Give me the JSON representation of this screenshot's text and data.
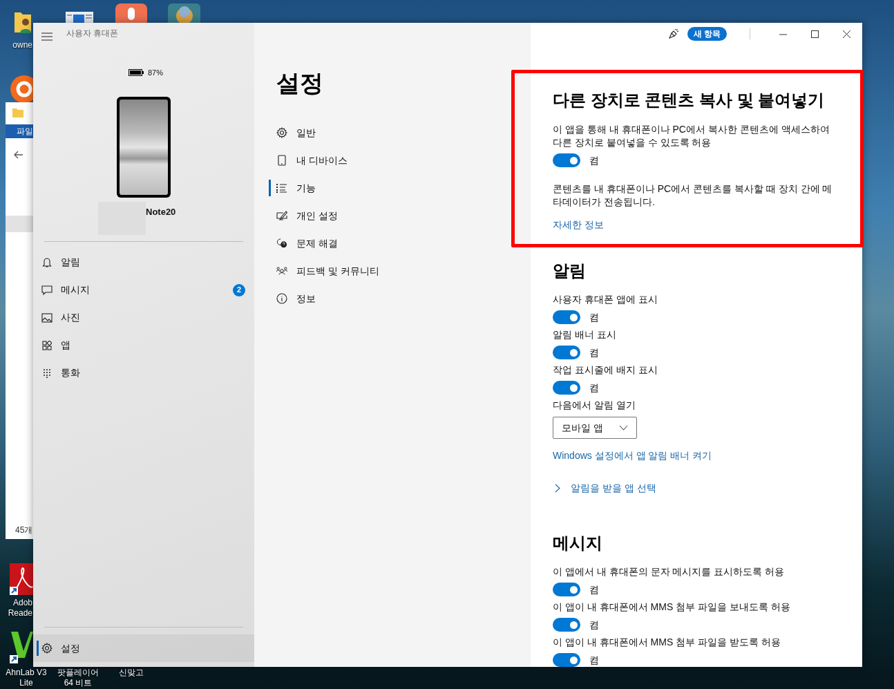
{
  "desktop": {
    "icons": [
      {
        "lines": [
          "owne"
        ]
      },
      {
        "lines": [
          "Adob",
          "Reade"
        ]
      },
      {
        "lines": [
          "AhnLab V3",
          "Lite"
        ]
      },
      {
        "lines": [
          "팟플레이어",
          "64 비트"
        ]
      },
      {
        "lines": [
          "신맞고"
        ]
      }
    ]
  },
  "background_window": {
    "ribbon_tab": "파일",
    "status": "45개"
  },
  "app": {
    "title": "사용자 휴대폰",
    "battery": "87%",
    "device_name": "Note20",
    "nav": [
      {
        "label": "알림",
        "selected": false
      },
      {
        "label": "메시지",
        "selected": false,
        "badge": "2"
      },
      {
        "label": "사진",
        "selected": false
      },
      {
        "label": "앱",
        "selected": false
      },
      {
        "label": "통화",
        "selected": false
      }
    ],
    "footer_nav": {
      "label": "설정",
      "selected": true
    },
    "settings_title": "설정",
    "settings_nav": [
      {
        "label": "일반",
        "selected": false
      },
      {
        "label": "내 디바이스",
        "selected": false
      },
      {
        "label": "기능",
        "selected": true
      },
      {
        "label": "개인 설정",
        "selected": false
      },
      {
        "label": "문제 해결",
        "selected": false
      },
      {
        "label": "피드백 및 커뮤니티",
        "selected": false
      },
      {
        "label": "정보",
        "selected": false
      }
    ],
    "whats_new": "새 항목",
    "sections": [
      {
        "title": "다른 장치로 콘텐츠 복사 및 붙여넣기",
        "highlighted": true,
        "rows": [
          {
            "kind": "description",
            "text": "이 앱을 통해 내 휴대폰이나 PC에서 복사한 콘텐츠에 액세스하여 다른 장치로 붙여넣을 수 있도록 허용"
          },
          {
            "kind": "toggle",
            "on": true,
            "state_label": "켬"
          },
          {
            "kind": "note",
            "text": "콘텐츠를 내 휴대폰이나 PC에서 콘텐츠를 복사할 때 장치 간에 메타데이터가 전송됩니다."
          },
          {
            "kind": "link",
            "text": "자세한 정보"
          }
        ]
      },
      {
        "title": "알림",
        "highlighted": false,
        "rows": [
          {
            "kind": "description",
            "text": "사용자 휴대폰 앱에 표시"
          },
          {
            "kind": "toggle",
            "on": true,
            "state_label": "켬"
          },
          {
            "kind": "description",
            "text": "알림 배너 표시"
          },
          {
            "kind": "toggle",
            "on": true,
            "state_label": "켬"
          },
          {
            "kind": "description",
            "text": "작업 표시줄에 배지 표시"
          },
          {
            "kind": "toggle",
            "on": true,
            "state_label": "켬"
          },
          {
            "kind": "description",
            "text": "다음에서 알림 열기"
          },
          {
            "kind": "dropdown",
            "value": "모바일 앱"
          },
          {
            "kind": "link",
            "text": "Windows 설정에서 앱 알림 배너 켜기"
          },
          {
            "kind": "expander",
            "text": "알림을 받을 앱 선택"
          }
        ]
      },
      {
        "title": "메시지",
        "highlighted": false,
        "rows": [
          {
            "kind": "description",
            "text": "이 앱에서 내 휴대폰의 문자 메시지를 표시하도록 허용"
          },
          {
            "kind": "toggle",
            "on": true,
            "state_label": "켬"
          },
          {
            "kind": "description",
            "text": "이 앱이 내 휴대폰에서 MMS 첨부 파일을 보내도록 허용"
          },
          {
            "kind": "toggle",
            "on": true,
            "state_label": "켬"
          },
          {
            "kind": "description",
            "text": "이 앱이 내 휴대폰에서 MMS 첨부 파일을 받도록 허용"
          },
          {
            "kind": "toggle",
            "on": true,
            "state_label": "켬"
          }
        ]
      }
    ]
  }
}
